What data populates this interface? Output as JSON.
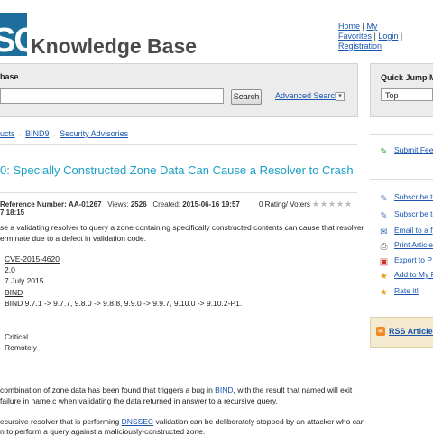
{
  "header": {
    "logo_text": "SC",
    "title": "Knowledge Base",
    "top_links": [
      "Home",
      "My Favorites",
      "Login",
      "Registration"
    ]
  },
  "search": {
    "title": "base",
    "button": "Search",
    "advanced": "Advanced Search",
    "chevron": "v"
  },
  "quick_jump": {
    "title": "Quick Jump Menu",
    "selected": "Top"
  },
  "breadcrumb": [
    "ucts",
    "BIND9",
    "Security Advisories"
  ],
  "article": {
    "title": "0: Specially Constructed Zone Data Can Cause a Resolver to Crash",
    "reference_label": "Reference Number:",
    "reference_value": "AA-01267",
    "views_label": "Views:",
    "views_value": "2526",
    "created_label": "Created:",
    "created_value": "2015-06-16 19:57",
    "time_cont": "7 18:15",
    "rating": "0 Rating/ Voters",
    "intro_line1": "se a validating resolver to query a zone containing specifically constructed contents can cause that resolver",
    "intro_line2": "erminate due to a defect in validation code.",
    "cve": "CVE-2015-4620",
    "version": "2.0",
    "date": "7 July 2015",
    "program": "BIND",
    "versions_affected": "BIND 9.7.1 -> 9.7.7, 9.8.0 -> 9.8.8, 9.9.0 -> 9.9.7, 9.10.0 -> 9.10.2-P1.",
    "severity": "Critical",
    "exploitable": "Remotely",
    "desc1_a": "combination of zone data has been found that triggers a bug in ",
    "desc1_link": "BIND",
    "desc1_b": ", with the result that named will exit",
    "desc1_line2": "failure in name.c when validating the data returned in answer to a recursive query.",
    "desc2_a": "ecursive resolver that is performing ",
    "desc2_link": "DNSSEC",
    "desc2_b": " validation can be deliberately stopped by an attacker who can",
    "desc2_line2": "n to perform a query against a maliciously-constructed zone."
  },
  "sidebar": {
    "submit_feedback": "Submit Feedback",
    "actions": [
      {
        "label": "Subscribe to",
        "icon": "subscribe-icon"
      },
      {
        "label": "Subscribe to",
        "icon": "subscribe-icon"
      },
      {
        "label": "Email to a f",
        "icon": "email-icon"
      },
      {
        "label": "Print Article",
        "icon": "print-icon"
      },
      {
        "label": "Export to P",
        "icon": "pdf-icon"
      },
      {
        "label": "Add to My F",
        "icon": "favorite-icon"
      },
      {
        "label": "Rate it!",
        "icon": "star-icon"
      }
    ],
    "rss": "RSS Articles"
  }
}
